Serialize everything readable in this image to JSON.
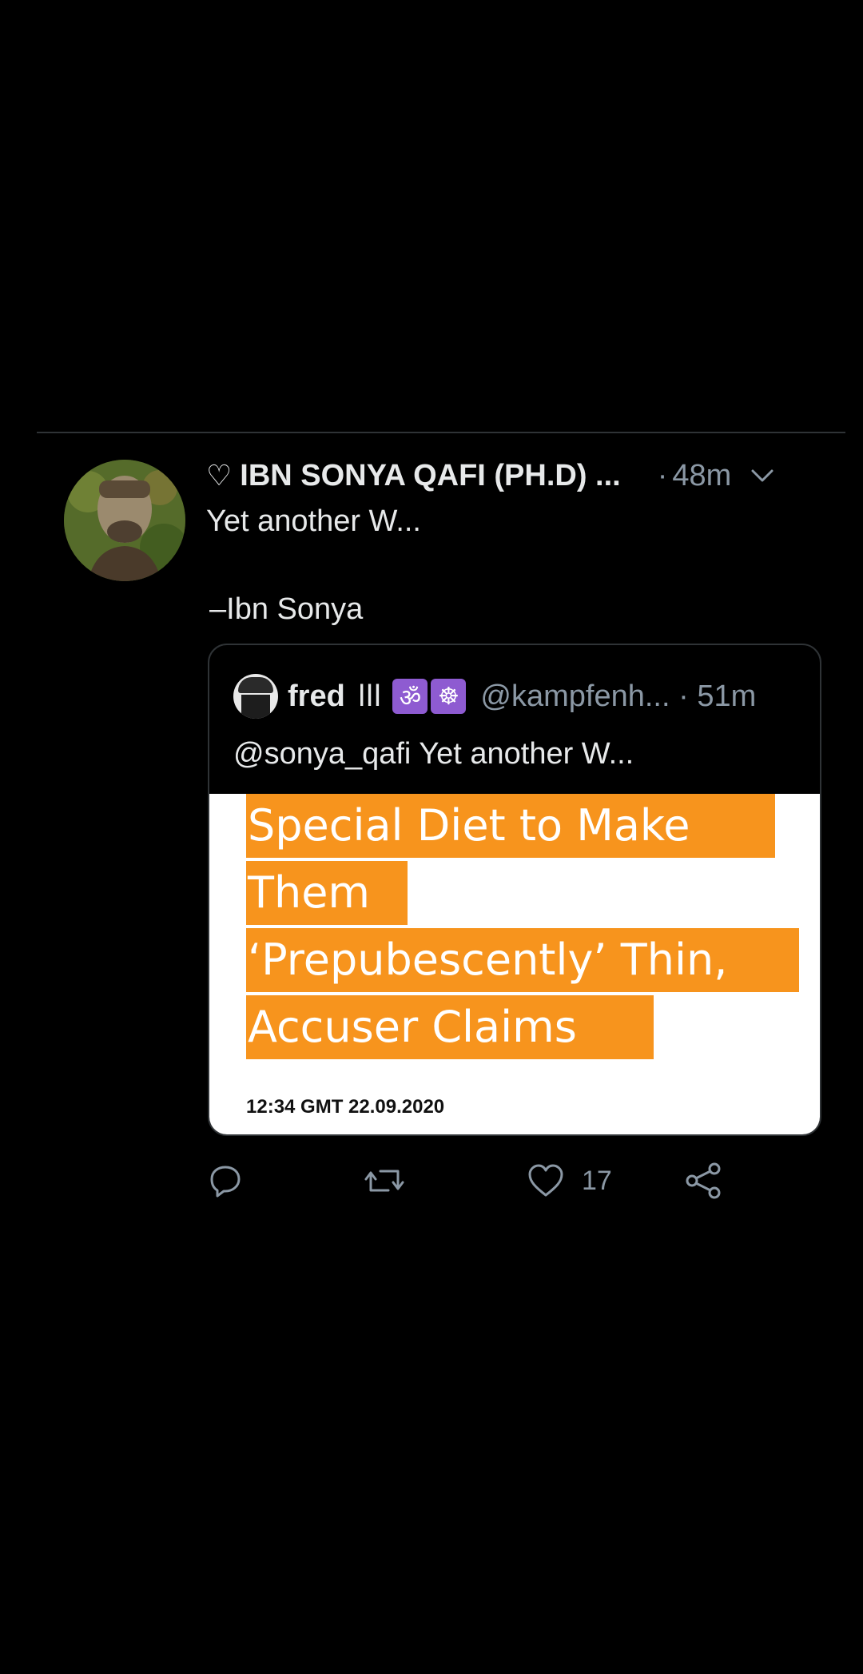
{
  "tweet": {
    "display_name": "IBN SONYA QAFI (PH.D) ...",
    "name_prefix_icon": "heart-outline-icon",
    "time_separator": "·",
    "time": "48m",
    "text": "Yet another W...",
    "signature": "–Ibn Sonya"
  },
  "quote": {
    "name": "fred",
    "bars": "ǀǀǀ",
    "emojis": [
      "ॐ",
      "☸"
    ],
    "handle": "@kampfenh...",
    "time_separator": "·",
    "time": "51m",
    "text": "@sonya_qafi Yet another W...",
    "image": {
      "headline_lines": [
        "Special Diet to Make",
        "Them",
        "‘Prepubescently’ Thin,",
        "Accuser Claims"
      ],
      "caption": "12:34 GMT 22.09.2020",
      "highlight_color": "#f7941d"
    }
  },
  "actions": {
    "reply_icon": "reply-icon",
    "retweet_icon": "retweet-icon",
    "like_icon": "heart-icon",
    "like_count": "17",
    "share_icon": "share-icon"
  },
  "colors": {
    "background": "#000000",
    "text": "#e7e9ea",
    "muted": "#8b98a5",
    "divider": "#2f3336"
  }
}
